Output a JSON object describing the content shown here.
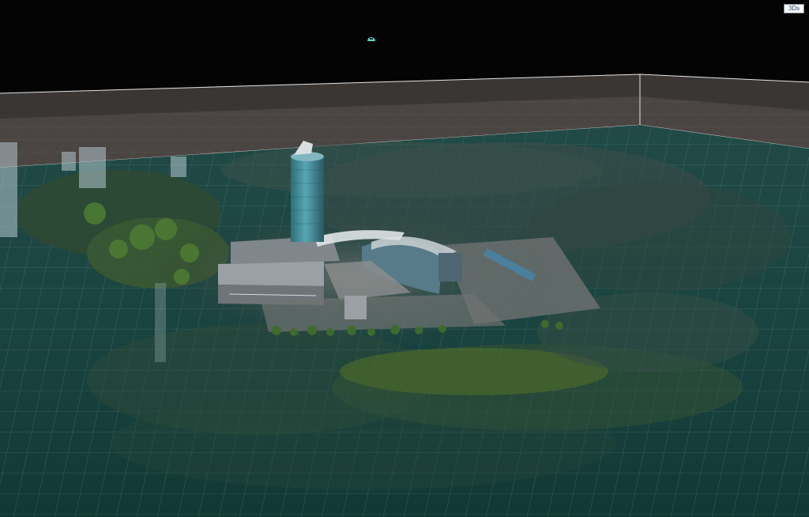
{
  "viewer": {
    "view_mode_label": "3Ds"
  },
  "colors": {
    "sky": "#040404",
    "back_wall": "#3b3836",
    "back_floor": "#4a4442",
    "ground_grid_fill": "#17423f",
    "grid_line": "#8fb3ad",
    "box_edge": "#e6e6e6",
    "glass_tower": "#3f8c98",
    "roof_gray": "#8e959b",
    "vegetation": "#35512d",
    "lawn": "#4f6b2c",
    "compass_marker": "#5fd6c2"
  },
  "icons": {
    "compass_marker": "compass-marker-icon"
  }
}
